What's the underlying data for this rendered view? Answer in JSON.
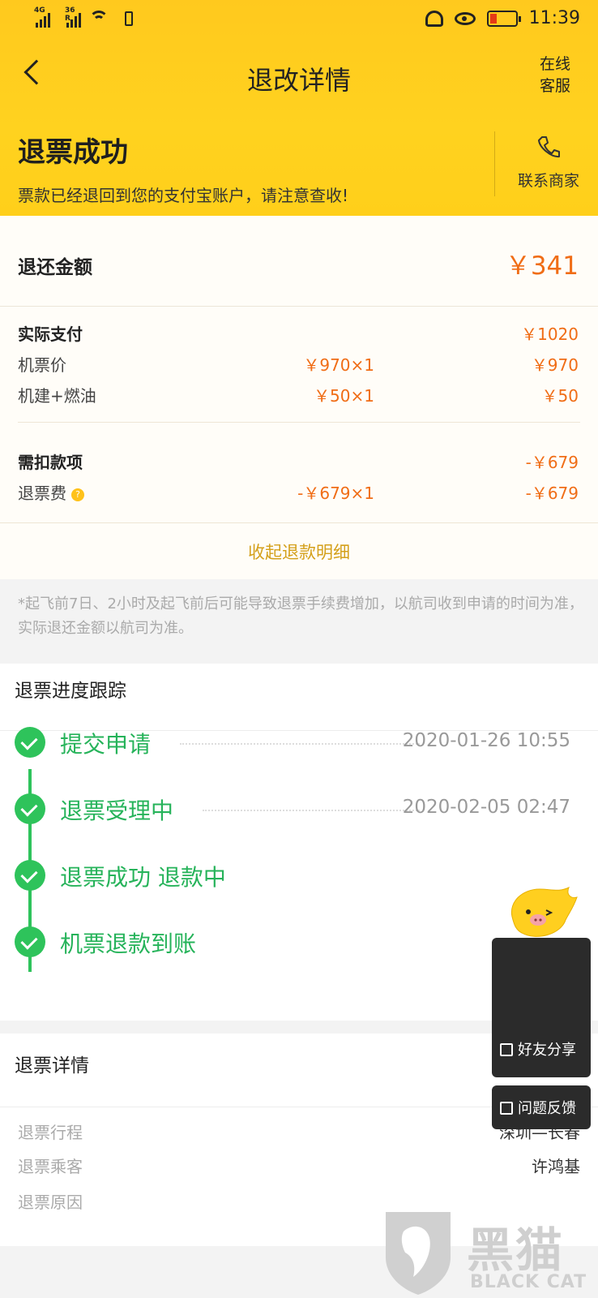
{
  "statusbar": {
    "net1": "4G",
    "net2": "36 R",
    "time": "11:39"
  },
  "navbar": {
    "title": "退改详情",
    "customer_service": "在线客服"
  },
  "status": {
    "title": "退票成功",
    "subtitle": "票款已经退回到您的支付宝账户，请注意查收!",
    "contact_label": "联系商家"
  },
  "refund": {
    "amount_label": "退还金额",
    "amount_value": "￥341",
    "paid": {
      "label": "实际支付",
      "total": "￥1020",
      "items": [
        {
          "label": "机票价",
          "unit": "￥970×1",
          "total": "￥970"
        },
        {
          "label": "机建+燃油",
          "unit": "￥50×1",
          "total": "￥50"
        }
      ]
    },
    "deductions": {
      "label": "需扣款项",
      "total": "-￥679",
      "items": [
        {
          "label": "退票费",
          "unit": "-￥679×1",
          "total": "-￥679"
        }
      ]
    },
    "collapse_label": "收起退款明细"
  },
  "note": "*起飞前7日、2小时及起飞前后可能导致退票手续费增加，以航司收到申请的时间为准，实际退还金额以航司为准。",
  "progress": {
    "title": "退票进度跟踪",
    "steps": [
      {
        "label": "提交申请",
        "time": "2020-01-26 10:55"
      },
      {
        "label": "退票受理中",
        "time": "2020-02-05 02:47"
      },
      {
        "label": "退票成功 退款中",
        "time": ""
      },
      {
        "label": "机票退款到账",
        "time": ""
      }
    ]
  },
  "details": {
    "title": "退票详情",
    "rows": [
      {
        "key": "退票行程",
        "value": "深圳—长春"
      },
      {
        "key": "退票乘客",
        "value": "许鸿基"
      },
      {
        "key": "退票原因",
        "value": ""
      }
    ]
  },
  "floating": {
    "share": "好友分享",
    "feedback": "问题反馈"
  },
  "watermark": {
    "text": "黑猫",
    "sub": "BLACK CAT"
  },
  "colors": {
    "header": "#ffd21f",
    "accent_orange": "#f06d16",
    "success_green": "#2ec35b",
    "collapse_gold": "#d4a01b"
  }
}
